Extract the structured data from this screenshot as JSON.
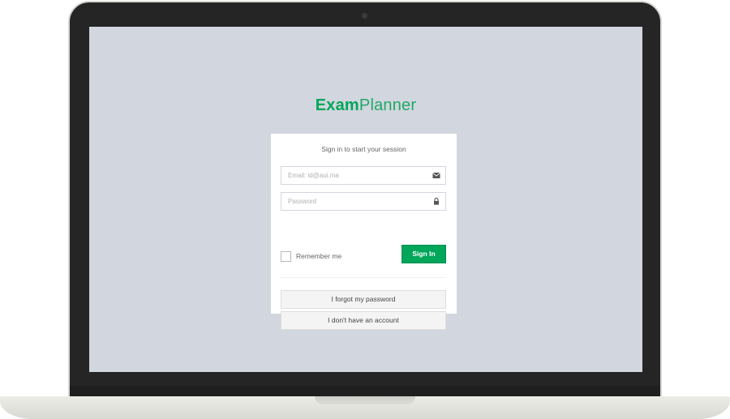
{
  "logo": {
    "bold_text": "Exam",
    "light_text": "Planner",
    "brand_color": "#00a65a"
  },
  "login": {
    "message": "Sign in to start your session",
    "email_placeholder": "Email: id@aui.ma",
    "email_icon": "envelope-icon",
    "password_placeholder": "Password",
    "password_icon": "lock-icon",
    "remember_label": "Remember me",
    "signin_label": "Sign In",
    "forgot_label": "I forgot my password",
    "no_account_label": "I don't have an account"
  },
  "colors": {
    "screen_background": "#d2d6de",
    "button_green": "#00a65a"
  }
}
